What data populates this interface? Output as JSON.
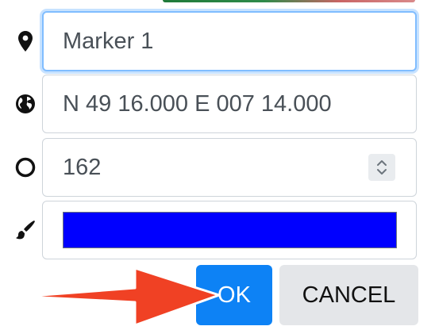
{
  "dialog": {
    "name_field": {
      "value": "Marker 1",
      "icon": "map-marker-icon"
    },
    "coordinates_field": {
      "value": "N 49 16.000 E 007 14.000",
      "icon": "globe-icon"
    },
    "radius_field": {
      "value": "162",
      "icon": "circle-icon"
    },
    "color_field": {
      "icon": "paintbrush-icon",
      "color": "#0000ff"
    },
    "buttons": {
      "ok_label": "OK",
      "cancel_label": "CANCEL"
    }
  },
  "annotation": {
    "arrow_color": "#f04124"
  },
  "colors": {
    "primary_button": "#0d82f5",
    "secondary_button": "#e4e6e9",
    "focus_border": "#80bdff"
  }
}
